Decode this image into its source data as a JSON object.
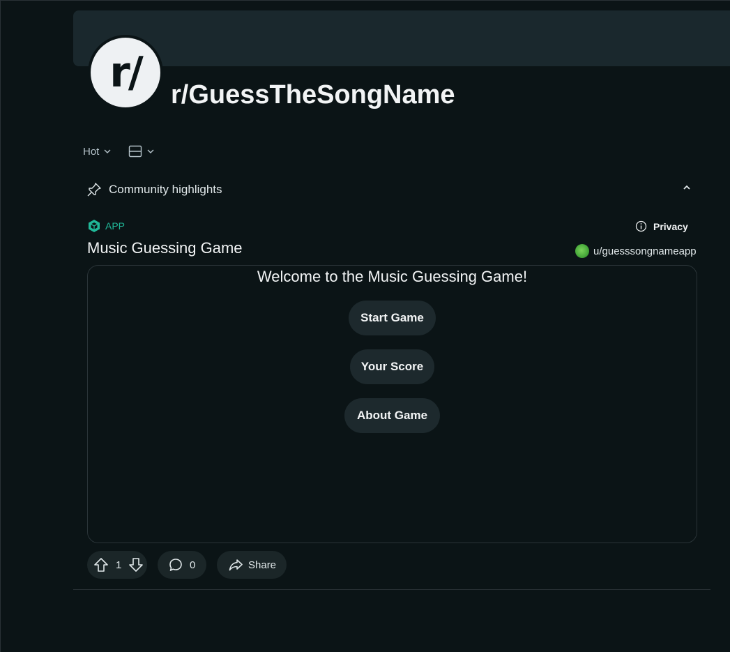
{
  "subreddit": {
    "avatar_text": "r/",
    "name": "r/GuessTheSongName"
  },
  "feed_controls": {
    "sort_label": "Hot",
    "sort_icon": "chevron-down-icon",
    "view_icon": "card-layout-icon"
  },
  "community_highlights": {
    "label": "Community highlights",
    "icon": "pin-icon",
    "collapse_icon": "chevron-up-icon"
  },
  "post": {
    "app_label": "APP",
    "privacy_label": "Privacy",
    "title": "Music Guessing Game",
    "author": "u/guesssongnameapp",
    "game": {
      "welcome": "Welcome to the Music Guessing Game!",
      "buttons": [
        "Start Game",
        "Your Score",
        "About Game"
      ]
    },
    "actions": {
      "votes": "1",
      "comments": "0",
      "share_label": "Share"
    }
  },
  "colors": {
    "background": "#0b1416",
    "banner": "#1a282d",
    "accent_app": "#20b898",
    "button_bg": "#1d292d"
  }
}
